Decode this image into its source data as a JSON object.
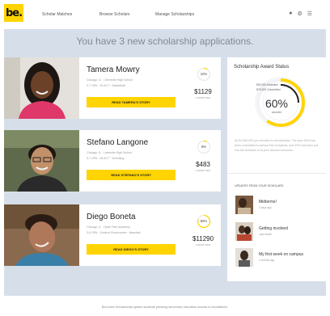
{
  "header": {
    "logo_text": "be.",
    "nav": [
      "Scholar Matches",
      "Browse Scholars",
      "Manage Scholarships"
    ],
    "icons": [
      "user-icon",
      "gear-icon",
      "menu-icon"
    ]
  },
  "headline": "You have 3 new scholarship applications.",
  "applications": [
    {
      "name": "Tamera Mowry",
      "meta1": "Chicago, IL   ·   Clemente High School",
      "meta2": "3.7 GPA   ·   25 ACT   ·   Basketball",
      "button": "READ TAMERA'S STORY",
      "ring": "10%",
      "ring_fraction": 0.1,
      "amount": "$1129",
      "amount_label": "COMMITTED"
    },
    {
      "name": "Stefano Langone",
      "meta1": "Chicago, IL   ·   Lakeside High School",
      "meta2": "3.7 GPA   ·   28 ACT   ·   Wrestling",
      "button": "READ STEFANO'S STORY",
      "ring": "8%",
      "ring_fraction": 0.08,
      "amount": "$483",
      "amount_label": "COMMITTED"
    },
    {
      "name": "Diego Boneta",
      "meta1": "Chicago, IL   ·   Hyde Park Academy",
      "meta2": "3.6 GPA   ·   Student Government   ·   Baseball",
      "button": "READ DIEGO'S STORY",
      "ring": "80%",
      "ring_fraction": 0.8,
      "amount": "$11290",
      "amount_label": "COMMITTED"
    }
  ],
  "award_status": {
    "title": "Scholarship Award Status",
    "line1": "$30,000 Awarded",
    "line2": "$75,000 Committed",
    "percent": "60%",
    "percent_fraction": 0.6,
    "sub": "awarded",
    "paragraph": "At the $30,000 you decided to scholarships. The your 60% has been committed to various first recipients, and 40% has been put into the Scholars of at your secured accounts."
  },
  "updates": {
    "title": "UPDATES FROM YOUR SCHOLARS",
    "items": [
      {
        "text": "Midterms!",
        "time": "2 days ago"
      },
      {
        "text": "Getting involved",
        "time": "Last month"
      },
      {
        "text": "My first week on campus",
        "time": "2 months ago"
      }
    ]
  },
  "footer": "Be/Leave Scholarships grants students pursuing secondary education access to foundations.",
  "colors": {
    "accent": "#ffd400",
    "stage": "#d6dfe9",
    "card": "#ffffff",
    "ring_track": "#e8e8e8"
  }
}
